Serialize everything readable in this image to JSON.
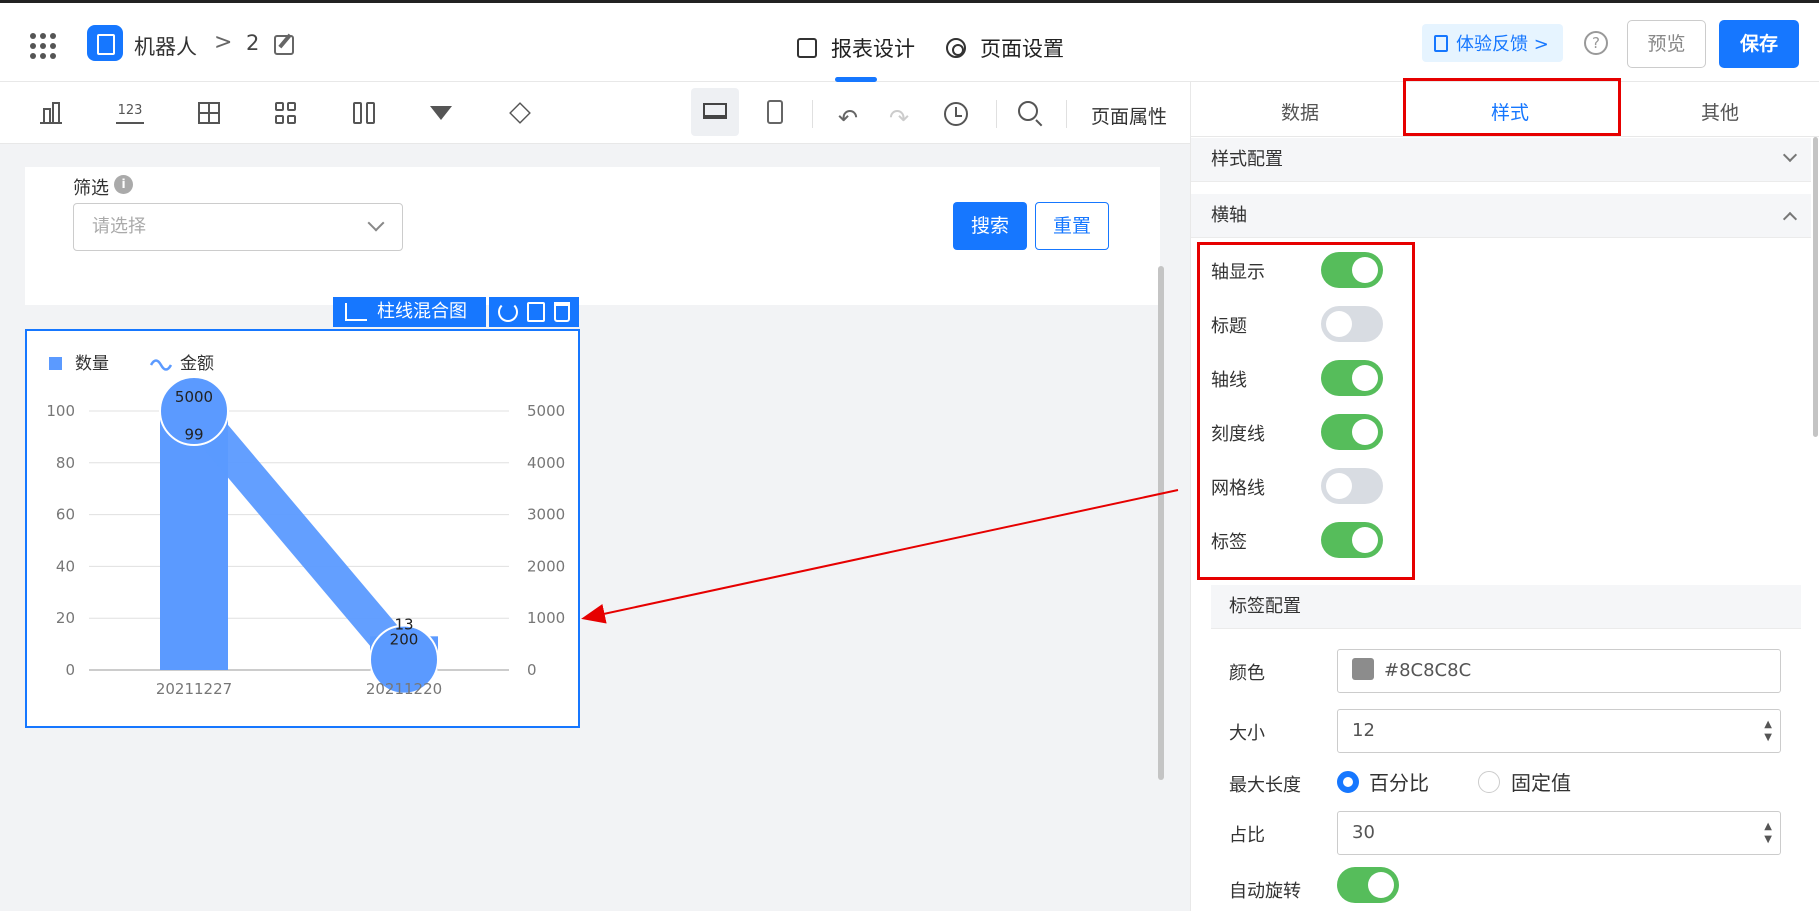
{
  "header": {
    "app_name": "机器人",
    "crumb_sep": ">",
    "crumb_num": "2",
    "tab_report": "报表设计",
    "tab_page": "页面设置",
    "feedback": "体验反馈 >",
    "help": "?",
    "preview": "预览",
    "save": "保存"
  },
  "toolbar": {
    "number_icon_text": "123",
    "page_props": "页面属性"
  },
  "filter": {
    "label": "筛选",
    "info": "i",
    "placeholder": "请选择",
    "search": "搜索",
    "reset": "重置"
  },
  "widget": {
    "label": "柱线混合图"
  },
  "chart_data": {
    "type": "bar",
    "categories": [
      "20211227",
      "20211220"
    ],
    "series": [
      {
        "name": "数量",
        "kind": "bar",
        "axis": "left",
        "values": [
          99,
          13
        ],
        "color": "#5b9aff"
      },
      {
        "name": "金额",
        "kind": "line",
        "axis": "right",
        "values": [
          5000,
          200
        ],
        "color": "#5b9aff"
      }
    ],
    "ylim_left": [
      0,
      100
    ],
    "ylim_right": [
      0,
      5000
    ],
    "yticks_left": [
      0,
      20,
      40,
      60,
      80,
      100
    ],
    "yticks_right": [
      0,
      1000,
      2000,
      3000,
      4000,
      5000
    ],
    "grid": true,
    "legend": "top-left"
  },
  "panel": {
    "tab_data": "数据",
    "tab_style": "样式",
    "tab_other": "其他",
    "section_style": "样式配置",
    "section_axis": "横轴",
    "toggles": [
      {
        "label": "轴显示",
        "on": true
      },
      {
        "label": "标题",
        "on": false
      },
      {
        "label": "轴线",
        "on": true
      },
      {
        "label": "刻度线",
        "on": true
      },
      {
        "label": "网格线",
        "on": false
      },
      {
        "label": "标签",
        "on": true
      }
    ],
    "label_config": "标签配置",
    "color_label": "颜色",
    "color_value": "#8C8C8C",
    "size_label": "大小",
    "size_value": "12",
    "maxlen_label": "最大长度",
    "radio_percent": "百分比",
    "radio_fixed": "固定值",
    "ratio_label": "占比",
    "ratio_value": "30",
    "autorotate_label": "自动旋转",
    "autorotate_on": true
  },
  "colors": {
    "accent": "#1677ff",
    "toggle_on": "#56bd5b",
    "highlight": "#e60000"
  }
}
